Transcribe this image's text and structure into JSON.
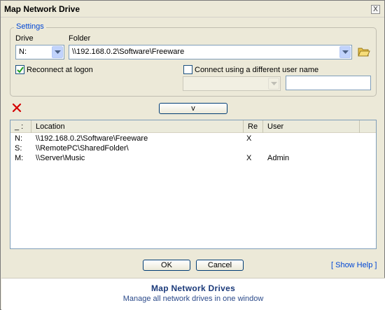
{
  "window": {
    "title": "Map Network Drive",
    "close_label": "X"
  },
  "settings": {
    "legend": "Settings",
    "drive_label": "Drive",
    "folder_label": "Folder",
    "drive_value": "N:",
    "folder_value": "\\\\192.168.0.2\\Software\\Freeware",
    "reconnect_label": "Reconnect at logon",
    "reconnect_checked": true,
    "different_user_label": "Connect using a different user name",
    "different_user_checked": false,
    "user_combo_value": "",
    "password_value": ""
  },
  "toolbar": {
    "delete_icon": "red-x-icon",
    "toggle_label": "v"
  },
  "list": {
    "columns": [
      "_ :",
      "Location",
      "Re",
      "User"
    ],
    "rows": [
      {
        "drive": "N:",
        "location": "\\\\192.168.0.2\\Software\\Freeware",
        "reconnect": "X",
        "user": ""
      },
      {
        "drive": "S:",
        "location": "\\\\RemotePC\\SharedFolder\\",
        "reconnect": "",
        "user": ""
      },
      {
        "drive": "M:",
        "location": "\\\\Server\\Music",
        "reconnect": "X",
        "user": "Admin"
      }
    ]
  },
  "buttons": {
    "ok": "OK",
    "cancel": "Cancel",
    "help": "[ Show Help ]"
  },
  "footer": {
    "title": "Map Network Drives",
    "subtitle": "Manage all network drives in one window"
  },
  "colors": {
    "window_bg": "#ece9d8",
    "accent": "#0046d5",
    "delete_red": "#d40000"
  }
}
